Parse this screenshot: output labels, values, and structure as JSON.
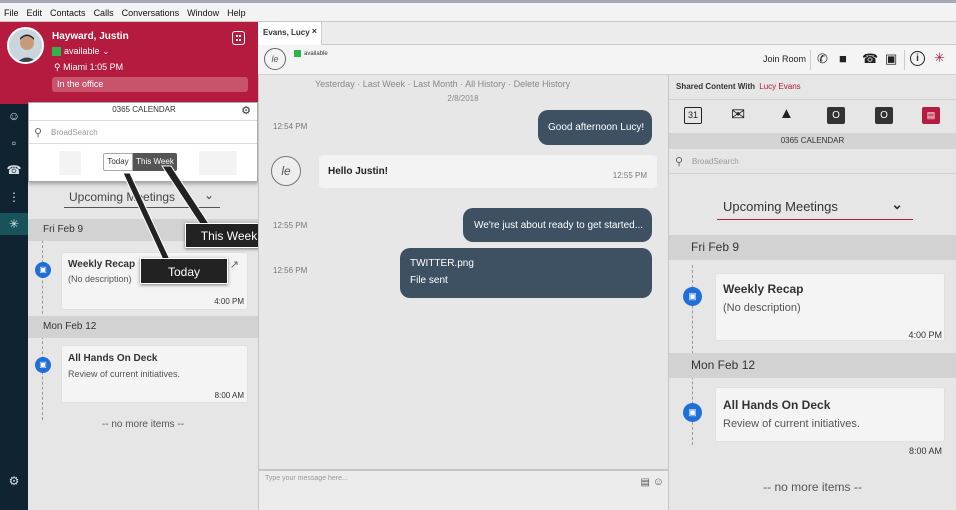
{
  "menu": [
    "File",
    "Edit",
    "Contacts",
    "Calls",
    "Conversations",
    "Window",
    "Help"
  ],
  "profile": {
    "name": "Hayward, Justin",
    "status": "available",
    "location": "Miami",
    "time": "1:05 PM",
    "note": "In the office"
  },
  "popup": {
    "title": "0365 CALENDAR",
    "search_placeholder": "BroadSearch",
    "today_label": "Today",
    "this_week_label": "This Week"
  },
  "left": {
    "meetings_select": "Upcoming Meetings",
    "day1": "Fri Feb 9",
    "event1": {
      "title": "Weekly Recap",
      "desc": "(No description)",
      "time": "4:00 PM"
    },
    "day2": "Mon Feb 12",
    "event2": {
      "title": "All Hands On Deck",
      "desc": "Review of current initiatives.",
      "time": "8:00 AM"
    },
    "no_more": "-- no more items --"
  },
  "callouts": {
    "this_week": "This Week",
    "today": "Today"
  },
  "chat": {
    "tab_label": "Evans, Lucy",
    "avatar_initials": "le",
    "contact_status": "available",
    "join_room": "Join Room",
    "history": [
      "Yesterday",
      "Last Week",
      "Last Month",
      "All History",
      "Delete History"
    ],
    "date": "2/8/2018",
    "messages": {
      "m1": {
        "time": "12:54 PM",
        "text": "Good afternoon Lucy!"
      },
      "m2": {
        "time": "12:55 PM",
        "text": "Hello Justin!"
      },
      "m3": {
        "time": "12:55 PM",
        "text": "We're just about ready to get started..."
      },
      "m4": {
        "time": "12:56 PM",
        "file": "TWITTER.png",
        "status": "File sent"
      }
    },
    "input_placeholder": "Type your message here..."
  },
  "right": {
    "shared_label": "Shared Content With",
    "shared_name": "Lucy Evans",
    "calendar_title": "0365 CALENDAR",
    "search_placeholder": "BroadSearch",
    "meetings_select": "Upcoming Meetings",
    "day1": "Fri Feb 9",
    "event1": {
      "title": "Weekly Recap",
      "desc": "(No description)",
      "time": "4:00 PM"
    },
    "day2": "Mon Feb 12",
    "event2": {
      "title": "All Hands On Deck",
      "desc": "Review of current initiatives.",
      "time": "8:00 AM"
    },
    "no_more": "-- no more items --"
  },
  "colors": {
    "brand": "#b41b3e",
    "bubble": "#3d5163",
    "rail": "#0f2430",
    "available": "#2eb44a"
  }
}
